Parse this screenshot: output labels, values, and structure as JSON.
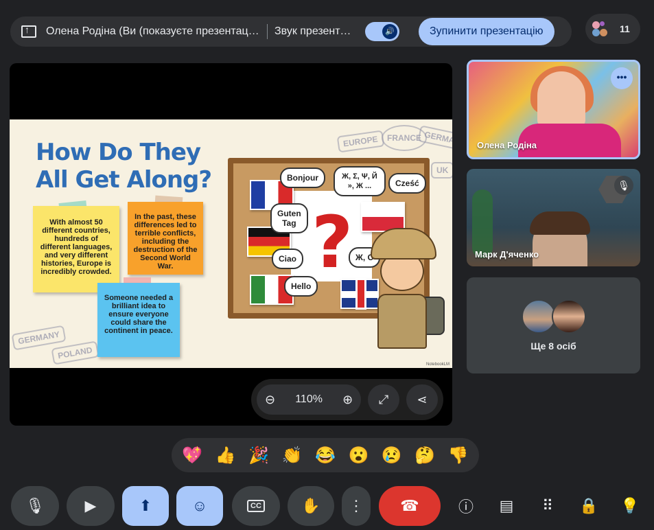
{
  "presenting_bar": {
    "text": "Олена Родіна (Ви (показуєте презентацію))",
    "audio_text": "Звук презентації",
    "stop_label": "Зупинити презентацію",
    "participants_count": "11"
  },
  "slide": {
    "title_line1": "How Do They",
    "title_line2": "All Get Along?",
    "note1": "With almost 50 different countries, hundreds of different languages, and very different histories, Europe is incredibly crowded.",
    "note2": "In the past, these differences led to terrible conflicts, including the destruction of the Second World War.",
    "note3": "Someone needed a brilliant idea to ensure everyone could share the continent in peace.",
    "bubbles": {
      "bonjour": "Bonjour",
      "symbols": "Ж, Σ, Ψ, Й », Ж ...",
      "czesc": "Cześć",
      "guten_tag": "Guten\nTag",
      "ciao": "Ciao",
      "hello": "Hello",
      "zh": "Ж, С"
    },
    "stamps": {
      "europe": "EUROPE",
      "france": "FRANCE",
      "germany_top": "GERMANY",
      "uk": "UK",
      "germany_bottom": "GERMANY",
      "poland": "POLAND"
    },
    "watermark": "NotebookLM"
  },
  "zoom": {
    "level": "110%"
  },
  "tiles": {
    "main_speaker": "Олена Родіна",
    "second": "Марк Д'яченко",
    "others": "Ще 8 осіб"
  },
  "reactions": [
    "💖",
    "👍",
    "🎉",
    "👏",
    "😂",
    "😮",
    "😢",
    "🤔",
    "👎"
  ],
  "colors": {
    "accent": "#a8c7fa",
    "end_call": "#dc362e",
    "surface": "#3c4043",
    "background": "#202124"
  }
}
